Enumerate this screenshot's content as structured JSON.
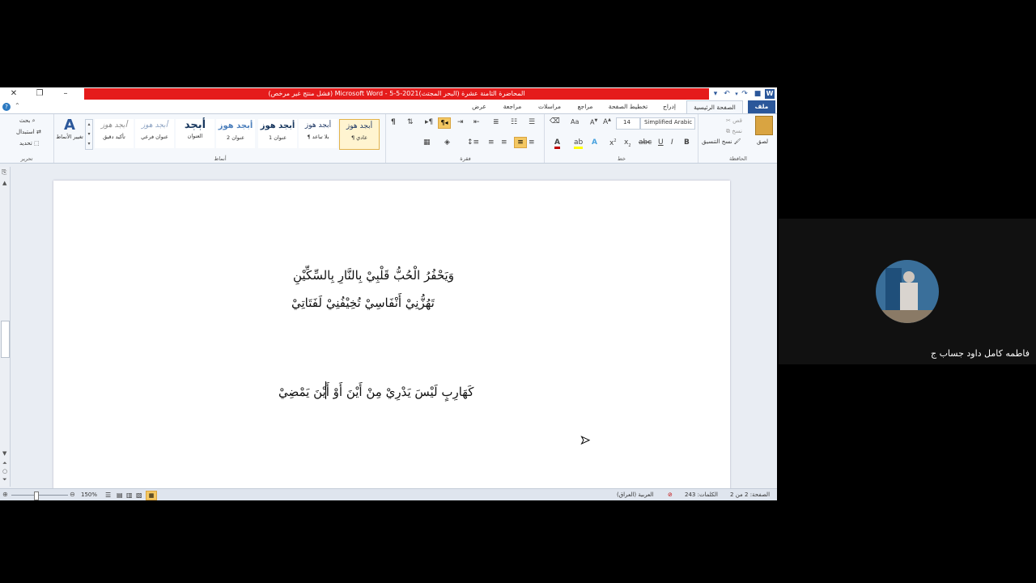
{
  "window": {
    "title": "المحاضرة الثامنة عشرة (البحر المجتث)2021-5-5 - Microsoft Word (فشل منتج غير مرخص)"
  },
  "tabs": [
    "ملف",
    "الصفحة الرئيسية",
    "إدراج",
    "تخطيط الصفحة",
    "مراجع",
    "مراسلات",
    "مراجعة",
    "عرض"
  ],
  "clipboard": {
    "paste": "لصق",
    "cut": "قص",
    "copy": "نسخ",
    "format_painter": "نسخ التنسيق",
    "label": "الحافظة"
  },
  "font": {
    "name": "Simplified Arabic",
    "size": "14",
    "label": "خط"
  },
  "paragraph": {
    "label": "فقرة"
  },
  "styles": {
    "items": [
      {
        "preview": "أبجد هوز",
        "name": "¶ عادي"
      },
      {
        "preview": "أبجد هوز",
        "name": "¶ بلا تباعد"
      },
      {
        "preview": "أبجد هوز",
        "name": "عنوان 1"
      },
      {
        "preview": "أبجد هوز",
        "name": "عنوان 2"
      },
      {
        "preview": "أبجد",
        "name": "العنوان"
      },
      {
        "preview": "أبجد هوز",
        "name": "عنوان فرعي"
      },
      {
        "preview": "أبجد هوز",
        "name": "تأكيد دقيق"
      }
    ],
    "change_styles": "تغيير الأنماط",
    "label": "أنماط"
  },
  "editing": {
    "find": "بحث",
    "replace": "استبدال",
    "select": "تحديد",
    "label": "تحرير"
  },
  "document": {
    "line1": "وَيَحْفُرُ الْحُبُّ قَلْبِيْ     بِالنَّارِ  بِالسِّكِّيْنِ",
    "line2": "تَهُزُّنِيْ     أَنْفَاسِيْ       تُخِيْفُنِيْ   لَفَتَاتِيْ",
    "line3": "كَهَارِبٍ لَيْسَ يَدْرِيْ       مِنْ أَيْنَ أَوْ أَيْنَ يَمْضِيْ"
  },
  "status": {
    "page": "الصفحة: 2 من 2",
    "words": "الكلمات: 243",
    "language": "العربية (العراق)",
    "zoom": "150%"
  },
  "meeting": {
    "participant_name": "فاطمه كامل داود جساب ج"
  },
  "colors": {
    "title_red": "#e51b1b",
    "accent_blue": "#2b579a",
    "font_color": "#c00000",
    "highlight": "#ffff00"
  }
}
